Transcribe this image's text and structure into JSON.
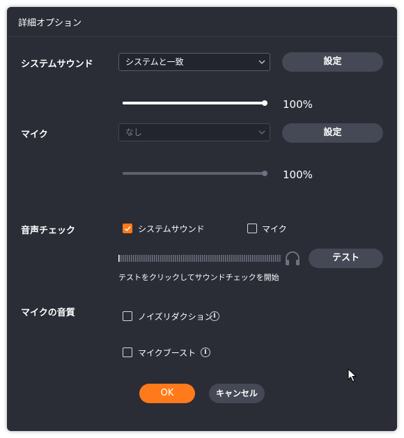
{
  "dialog": {
    "title": "詳細オプション"
  },
  "system_sound": {
    "label": "システムサウンド",
    "select_value": "システムと一致",
    "settings_label": "設定",
    "volume_text": "100%",
    "volume": 100
  },
  "mic": {
    "label": "マイク",
    "select_value": "なし",
    "settings_label": "設定",
    "volume_text": "100%",
    "volume": 100
  },
  "sound_check": {
    "label": "音声チェック",
    "system_sound_label": "システムサウンド",
    "system_sound_checked": true,
    "mic_label": "マイク",
    "mic_checked": false,
    "test_label": "テスト",
    "hint": "テストをクリックしてサウンドチェックを開始",
    "level": 0
  },
  "mic_quality": {
    "label": "マイクの音質",
    "noise_reduction_label": "ノイズリダクション",
    "noise_reduction_checked": false,
    "mic_boost_label": "マイクブースト",
    "mic_boost_checked": false
  },
  "footer": {
    "ok_label": "OK",
    "cancel_label": "キャンセル"
  },
  "colors": {
    "accent": "#ff7a1a",
    "panel": "#2a2c36",
    "button": "#454855"
  },
  "icons": {
    "chevron": "chevron-down-icon",
    "headphones": "headphones-icon",
    "info": "info-icon",
    "check": "check-icon",
    "cursor": "mouse-pointer-icon"
  }
}
